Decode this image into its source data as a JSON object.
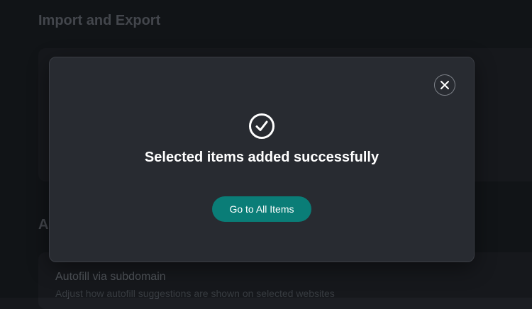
{
  "background": {
    "import_export_title": "Import and Export",
    "autofill_section_title": "A",
    "autofill_setting": {
      "title": "Autofill via subdomain",
      "description": "Adjust how autofill suggestions are shown on selected websites"
    }
  },
  "modal": {
    "title": "Selected items added successfully",
    "primary_button_label": "Go to All Items",
    "close_icon": "close-icon",
    "status_icon": "check-circle-icon"
  },
  "colors": {
    "page_background": "#16181c",
    "modal_background": "#282b31",
    "accent": "#0a7d77",
    "text_primary": "#ffffff"
  }
}
